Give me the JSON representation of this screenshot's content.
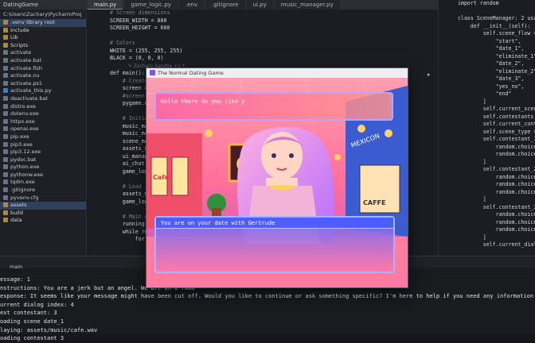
{
  "ide": {
    "project_label": "DatingGame",
    "path_label": "C:\\Users\\Zachary\\PycharmProj",
    "tabs": [
      "main.py",
      "game_logic.py",
      ".env",
      ".gitignore",
      "ui.py",
      "music_manager.py"
    ],
    "active_tab_index": 0,
    "tree": [
      {
        "label": ".venv library root",
        "kind": "folder",
        "sel": true
      },
      {
        "label": "Include",
        "kind": "folder"
      },
      {
        "label": "Lib",
        "kind": "folder"
      },
      {
        "label": "Scripts",
        "kind": "folder"
      },
      {
        "label": "activate",
        "kind": "file"
      },
      {
        "label": "activate.bat",
        "kind": "file"
      },
      {
        "label": "activate.fish",
        "kind": "file"
      },
      {
        "label": "activate.nu",
        "kind": "file"
      },
      {
        "label": "activate.ps1",
        "kind": "file"
      },
      {
        "label": "activate_this.py",
        "kind": "py"
      },
      {
        "label": "deactivate.bat",
        "kind": "file"
      },
      {
        "label": "distro.exe",
        "kind": "file"
      },
      {
        "label": "dotenv.exe",
        "kind": "file"
      },
      {
        "label": "httpx.exe",
        "kind": "file"
      },
      {
        "label": "openai.exe",
        "kind": "file"
      },
      {
        "label": "pip.exe",
        "kind": "file"
      },
      {
        "label": "pip3.exe",
        "kind": "file"
      },
      {
        "label": "pip3.12.exe",
        "kind": "file"
      },
      {
        "label": "pydoc.bat",
        "kind": "file"
      },
      {
        "label": "python.exe",
        "kind": "file"
      },
      {
        "label": "pythonw.exe",
        "kind": "file"
      },
      {
        "label": "tqdm.exe",
        "kind": "file"
      },
      {
        "label": ".gitignore",
        "kind": "file"
      },
      {
        "label": "pyvenv.cfg",
        "kind": "file"
      },
      {
        "label": "assets",
        "kind": "folder",
        "sel": true
      },
      {
        "label": "build",
        "kind": "folder"
      },
      {
        "label": "data",
        "kind": "folder"
      }
    ],
    "code_lines": [
      {
        "t": "# Screen dimensions",
        "c": "cm"
      },
      {
        "t": "SCREEN_WIDTH = 800"
      },
      {
        "t": "SCREEN_HEIGHT = 600"
      },
      {
        "t": ""
      },
      {
        "t": "# Colors",
        "c": "cm"
      },
      {
        "t": "WHITE = (255, 255, 255)"
      },
      {
        "t": "BLACK = (0, 0, 0)"
      },
      {
        "t": "            ✎ Zachary Sarette +1 *",
        "c": "hint"
      },
      {
        "t": "def main():"
      },
      {
        "t": "    # Create S",
        "c": "cm"
      },
      {
        "t": "    screen = p"
      },
      {
        "t": "    #screen = p",
        "c": "cm"
      },
      {
        "t": "    pygame.disp"
      },
      {
        "t": ""
      },
      {
        "t": "    # Initiali",
        "c": "cm"
      },
      {
        "t": "    music_mana"
      },
      {
        "t": "    music_mana"
      },
      {
        "t": "    scene_mana"
      },
      {
        "t": "    assets_man"
      },
      {
        "t": "    ui_manager"
      },
      {
        "t": "    ai_chat ="
      },
      {
        "t": "    game_logic"
      },
      {
        "t": ""
      },
      {
        "t": "    # Load ini",
        "c": "cm"
      },
      {
        "t": "    assets_man"
      },
      {
        "t": "    game_logic"
      },
      {
        "t": ""
      },
      {
        "t": "    # Main gam",
        "c": "cm"
      },
      {
        "t": "    running ="
      },
      {
        "t": "    while runn"
      },
      {
        "t": "        for ev"
      },
      {
        "t": "            if"
      }
    ],
    "right_code": [
      {
        "t": "import random"
      },
      {
        "t": ""
      },
      {
        "t": "class SceneManager: 2 usages"
      },
      {
        "t": "    def __init__(self):"
      },
      {
        "t": "        self.scene_flow = ["
      },
      {
        "t": "            \"start\","
      },
      {
        "t": "            \"date_1\","
      },
      {
        "t": "            \"eliminate_1\","
      },
      {
        "t": "            \"date_2\","
      },
      {
        "t": "            \"eliminate_2\","
      },
      {
        "t": "            \"date_3\","
      },
      {
        "t": "            \"yes_no\","
      },
      {
        "t": "            \"end\""
      },
      {
        "t": "        ]"
      },
      {
        "t": "        self.current_scene_index"
      },
      {
        "t": "        self.contestants = [1, 2"
      },
      {
        "t": "        self.current_contestant"
      },
      {
        "t": "        self.scene_type = self.s"
      },
      {
        "t": "        self.contestant_1_date_q"
      },
      {
        "t": "            random.choice([0, 1"
      },
      {
        "t": "            random.choice([0, 1"
      },
      {
        "t": "        ]"
      },
      {
        "t": "        self.contestant_2_date_q"
      },
      {
        "t": "            random.choice([0, 1"
      },
      {
        "t": "            random.choice([0, 1"
      },
      {
        "t": "            random.choice([0, 1"
      },
      {
        "t": "        ]"
      },
      {
        "t": "        self.contestant_3_date_q"
      },
      {
        "t": "            random.choice([0, 1"
      },
      {
        "t": "            random.choice([0, 1"
      },
      {
        "t": "            random.choice([0, 1"
      },
      {
        "t": "        ]"
      },
      {
        "t": "        self.current_dialog_index"
      }
    ],
    "console_tab": "main",
    "console_lines": [
      "essage: 1",
      "nstructions: You are a jerk but an angel. We are on a roma",
      "esponse: It seems like your message might have been cut off. Would you like to continue or ask something specific? I'm here to help if you need any information or just to chat!",
      "urrent dialog index: 4",
      "ext contestant: 3",
      "oading scene date_1",
      "laying: assets/music/cafe.wav",
      "oading contestant 3"
    ]
  },
  "game": {
    "window_title": "The Normal Dating Game",
    "top_dialog": "Hello there do you like y",
    "bottom_dialog": "You are on your date with Gertrude",
    "signs": {
      "cafe": "CAFE",
      "coffee": "CAFFE",
      "diner": "MEXICON"
    }
  }
}
